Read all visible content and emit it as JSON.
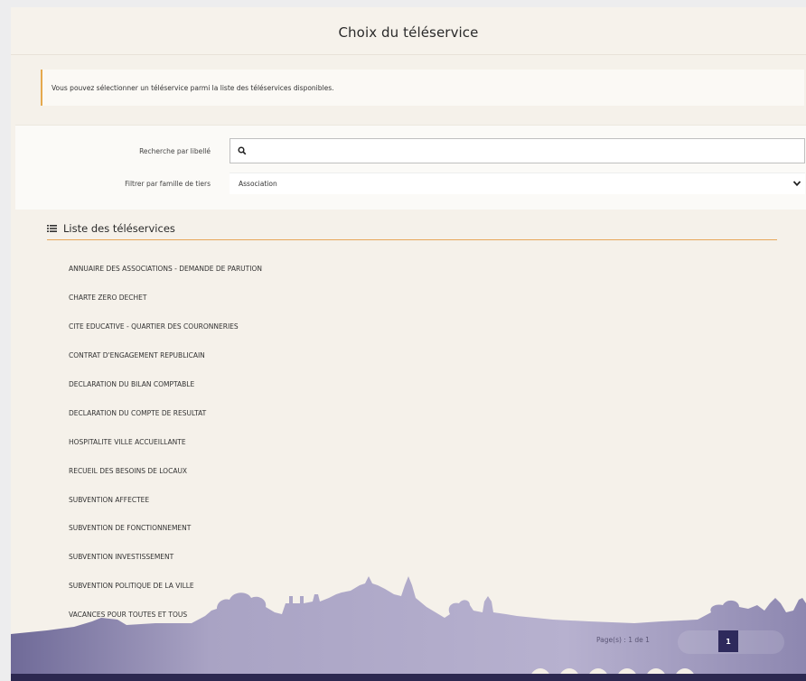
{
  "modal": {
    "title": "Choix du téléservice"
  },
  "info": {
    "text": "Vous pouvez sélectionner un téléservice parmi la liste des téléservices disponibles."
  },
  "filters": {
    "search_label": "Recherche par libellé",
    "search_value": "",
    "search_icon": "search-icon",
    "family_label": "Filtrer par famille de tiers",
    "family_value": "Association"
  },
  "list": {
    "header": "Liste des téléservices",
    "header_icon": "list-icon",
    "items": [
      "ANNUAIRE DES ASSOCIATIONS - DEMANDE DE PARUTION",
      "CHARTE ZERO DECHET",
      "CITE EDUCATIVE - QUARTIER DES COURONNERIES",
      "CONTRAT D'ENGAGEMENT REPUBLICAIN",
      "DECLARATION DU BILAN COMPTABLE",
      "DECLARATION DU COMPTE DE RESULTAT",
      "HOSPITALITE VILLE ACCUEILLANTE",
      "RECUEIL DES BESOINS DE LOCAUX",
      "SUBVENTION AFFECTEE",
      "SUBVENTION DE FONCTIONNEMENT",
      "SUBVENTION INVESTISSEMENT",
      "SUBVENTION POLITIQUE DE LA VILLE",
      "VACANCES POUR TOUTES ET TOUS"
    ]
  },
  "pagination": {
    "info": "Page(s) : 1 de 1",
    "current": "1"
  },
  "colors": {
    "accent": "#e5a94e",
    "background": "#f5f1ea",
    "skyline": "#a8a2c2",
    "page_button": "#2e2a5c"
  }
}
